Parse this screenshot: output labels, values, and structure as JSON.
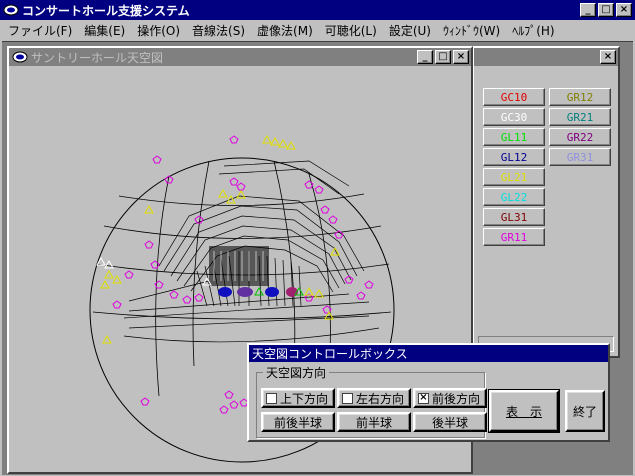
{
  "app": {
    "title": "コンサートホール支援システム",
    "controls": {
      "minimize": "_",
      "maximize": "□",
      "close": "×"
    }
  },
  "menu": [
    {
      "label": "ファイル(F)"
    },
    {
      "label": "編集(E)"
    },
    {
      "label": "操作(O)"
    },
    {
      "label": "音線法(S)"
    },
    {
      "label": "虚像法(M)"
    },
    {
      "label": "可聴化(L)"
    },
    {
      "label": "設定(U)"
    },
    {
      "label": "ｳｨﾝﾄﾞｳ(W)"
    },
    {
      "label": "ﾍﾙﾌﾟ(H)"
    }
  ],
  "sky_window": {
    "title": "サントリーホール天空図",
    "controls": {
      "minimize": "_",
      "maximize": "□",
      "close": "×"
    }
  },
  "group_panel": {
    "close": "×",
    "buttons": [
      {
        "label": "GC10",
        "color": "#e00000"
      },
      {
        "label": "GR12",
        "color": "#808000"
      },
      {
        "label": "GC30",
        "color": "#ffffff"
      },
      {
        "label": "GR21",
        "color": "#008080"
      },
      {
        "label": "GL11",
        "color": "#00e000"
      },
      {
        "label": "GR22",
        "color": "#800080"
      },
      {
        "label": "GL12",
        "color": "#000090"
      },
      {
        "label": "GR31",
        "color": "#9090e0"
      },
      {
        "label": "GL21",
        "color": "#e0e000"
      },
      {
        "label": "GL22",
        "color": "#00e0e0"
      },
      {
        "label": "GL31",
        "color": "#800000"
      },
      {
        "label": "GR11",
        "color": "#e000e0"
      }
    ]
  },
  "control_box": {
    "title": "天空図コントロールボックス",
    "group_label": "天空図方向",
    "checks": [
      {
        "label": "上下方向",
        "checked": false,
        "mark": ""
      },
      {
        "label": "左右方向",
        "checked": false,
        "mark": ""
      },
      {
        "label": "前後方向",
        "checked": true,
        "mark": "×"
      }
    ],
    "hemispheres": [
      "前後半球",
      "前半球",
      "後半球"
    ],
    "display_button": "表　示",
    "close_button": "終了"
  }
}
